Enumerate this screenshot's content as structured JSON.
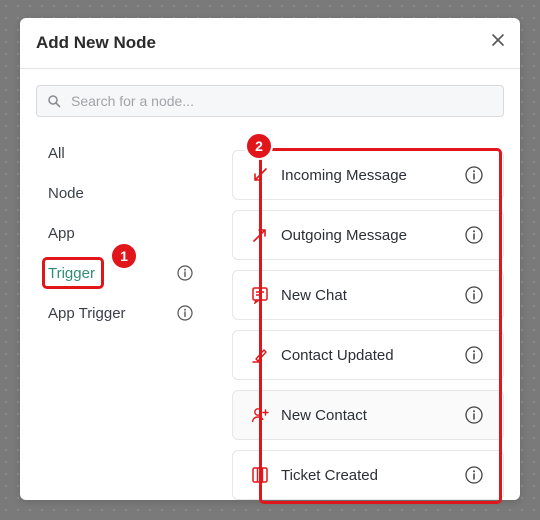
{
  "dialog": {
    "title": "Add New Node",
    "close_icon": "close-icon"
  },
  "search": {
    "placeholder": "Search for a node...",
    "value": "",
    "icon": "search-icon"
  },
  "categories": [
    {
      "label": "All",
      "active": false,
      "info": false
    },
    {
      "label": "Node",
      "active": false,
      "info": false
    },
    {
      "label": "App",
      "active": false,
      "info": false
    },
    {
      "label": "Trigger",
      "active": true,
      "info": true
    },
    {
      "label": "App Trigger",
      "active": false,
      "info": true
    }
  ],
  "nodes": [
    {
      "label": "Incoming Message",
      "icon": "incoming-arrow-icon"
    },
    {
      "label": "Outgoing Message",
      "icon": "outgoing-arrow-icon"
    },
    {
      "label": "New Chat",
      "icon": "chat-icon"
    },
    {
      "label": "Contact Updated",
      "icon": "edit-pencil-icon"
    },
    {
      "label": "New Contact",
      "icon": "add-user-icon"
    },
    {
      "label": "Ticket Created",
      "icon": "ticket-icon"
    }
  ],
  "annotations": {
    "badge_1": "1",
    "badge_2": "2"
  },
  "colors": {
    "accent_active": "#2f8f73",
    "node_icon": "#e0161b",
    "highlight": "#e0161b",
    "backdrop": "#7a7a7a"
  }
}
